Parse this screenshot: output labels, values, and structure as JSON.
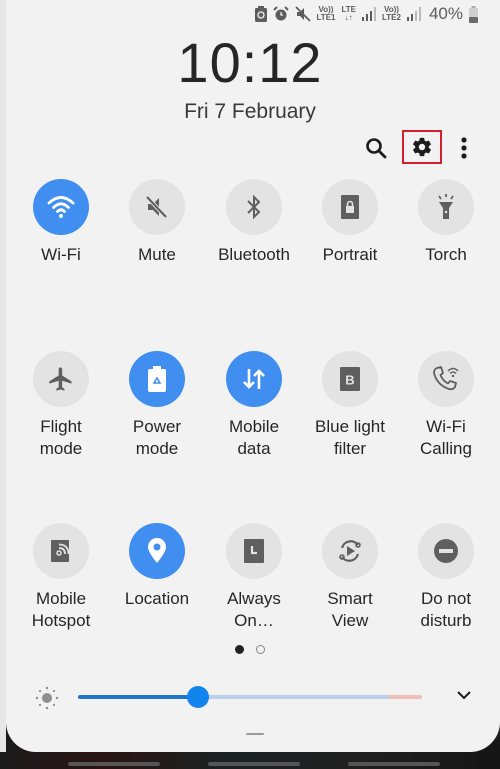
{
  "status_bar": {
    "icons": [
      "battery-saver-icon",
      "alarm-icon",
      "mute-icon",
      "volte-lte1-icon",
      "lte-data-icon",
      "signal-sim1-icon",
      "volte-lte2-icon",
      "signal-sim2-icon",
      "battery-icon"
    ],
    "volte1_top": "Vo))",
    "volte1_bottom": "LTE1",
    "lte_top": "LTE",
    "lte_bottom": "↓↑",
    "volte2_top": "Vo))",
    "volte2_bottom": "LTE2",
    "battery_percent": "40%",
    "battery_level": 0.4
  },
  "clock": {
    "time": "10:12",
    "date": "Fri 7 February"
  },
  "actions": {
    "search": "search-icon",
    "settings": "gear-icon",
    "more": "more-vertical-icon",
    "highlight_color": "#d32030"
  },
  "tiles": [
    {
      "label": "Wi-Fi",
      "icon": "wifi-icon",
      "on": true
    },
    {
      "label": "Mute",
      "icon": "mute-icon",
      "on": false
    },
    {
      "label": "Bluetooth",
      "icon": "bluetooth-icon",
      "on": false
    },
    {
      "label": "Portrait",
      "icon": "portrait-lock-icon",
      "on": false
    },
    {
      "label": "Torch",
      "icon": "torch-icon",
      "on": false
    },
    {
      "label": "Flight\nmode",
      "icon": "airplane-icon",
      "on": false
    },
    {
      "label": "Power\nmode",
      "icon": "power-mode-icon",
      "on": true
    },
    {
      "label": "Mobile\ndata",
      "icon": "mobile-data-icon",
      "on": true
    },
    {
      "label": "Blue light\nfilter",
      "icon": "blue-light-filter-icon",
      "on": false
    },
    {
      "label": "Wi-Fi\nCalling",
      "icon": "wifi-calling-icon",
      "on": false
    },
    {
      "label": "Mobile\nHotspot",
      "icon": "hotspot-icon",
      "on": false
    },
    {
      "label": "Location",
      "icon": "location-icon",
      "on": true
    },
    {
      "label": "Always\nOn…",
      "icon": "always-on-display-icon",
      "on": false
    },
    {
      "label": "Smart\nView",
      "icon": "smart-view-icon",
      "on": false
    },
    {
      "label": "Do not\ndisturb",
      "icon": "do-not-disturb-icon",
      "on": false
    }
  ],
  "pager": {
    "current_page": 1,
    "total_pages": 2
  },
  "brightness": {
    "level": 0.35,
    "icon": "brightness-icon",
    "expand_icon": "chevron-down-icon"
  },
  "colors": {
    "accent": "#3f8ef0",
    "slider": "#1284ee",
    "panel_bg": "#f2f2f2",
    "tile_off_bg": "#e3e3e3"
  }
}
